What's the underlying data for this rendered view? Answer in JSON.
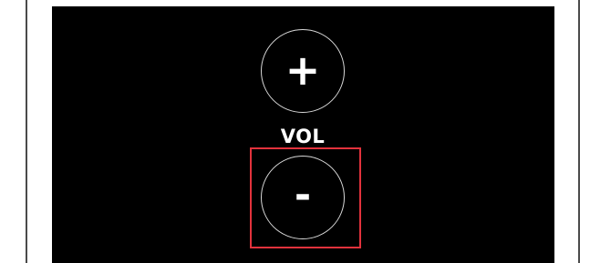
{
  "volume_control": {
    "increase_symbol": "+",
    "label": "VOL",
    "decrease_symbol": "-",
    "button_border_color": "#d9d9d9",
    "highlight_color": "#e2323c",
    "panel_color": "#000000"
  }
}
